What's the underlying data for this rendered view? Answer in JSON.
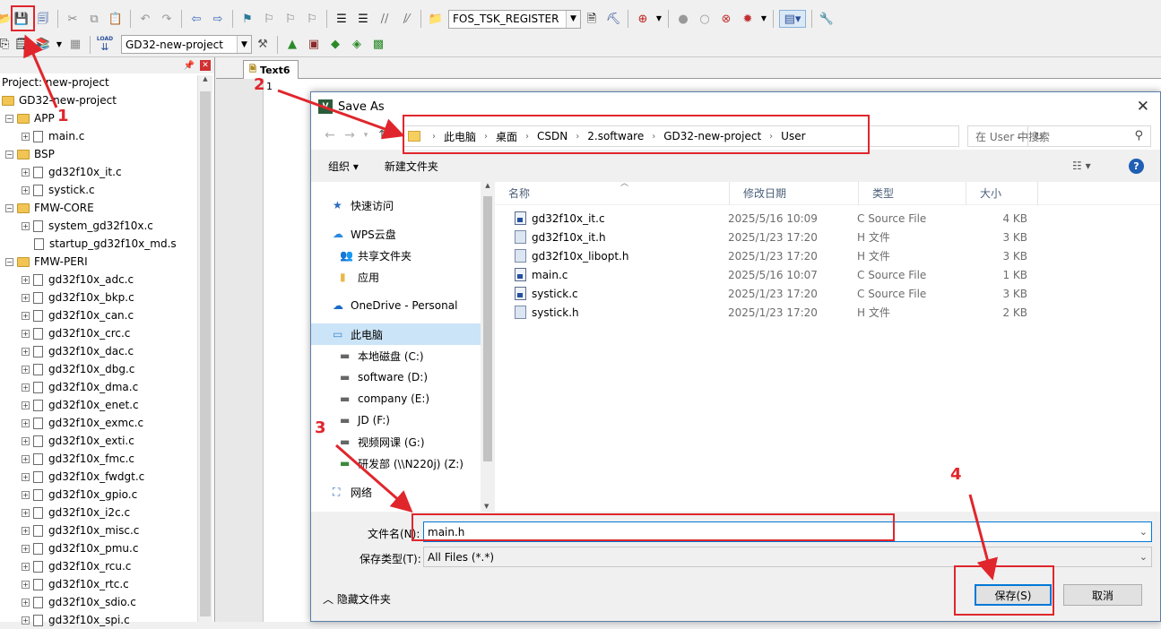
{
  "toolbar1": {
    "combo_value": "FOS_TSK_REGISTER"
  },
  "toolbar2": {
    "target_value": "GD32-new-project",
    "load_label": "LOAD"
  },
  "project": {
    "header": "Project: new-project",
    "root": "GD32-new-project",
    "groups": [
      {
        "name": "APP",
        "files": [
          "main.c"
        ]
      },
      {
        "name": "BSP",
        "files": [
          "gd32f10x_it.c",
          "systick.c"
        ]
      },
      {
        "name": "FMW-CORE",
        "files": [
          "system_gd32f10x.c",
          "startup_gd32f10x_md.s"
        ]
      },
      {
        "name": "FMW-PERI",
        "files": [
          "gd32f10x_adc.c",
          "gd32f10x_bkp.c",
          "gd32f10x_can.c",
          "gd32f10x_crc.c",
          "gd32f10x_dac.c",
          "gd32f10x_dbg.c",
          "gd32f10x_dma.c",
          "gd32f10x_enet.c",
          "gd32f10x_exmc.c",
          "gd32f10x_exti.c",
          "gd32f10x_fmc.c",
          "gd32f10x_fwdgt.c",
          "gd32f10x_gpio.c",
          "gd32f10x_i2c.c",
          "gd32f10x_misc.c",
          "gd32f10x_pmu.c",
          "gd32f10x_rcu.c",
          "gd32f10x_rtc.c",
          "gd32f10x_sdio.c",
          "gd32f10x_spi.c"
        ]
      }
    ]
  },
  "editor": {
    "tab": "Text6",
    "line_number": "1"
  },
  "dialog": {
    "title": "Save As",
    "breadcrumb": [
      "此电脑",
      "桌面",
      "CSDN",
      "2.software",
      "GD32-new-project",
      "User"
    ],
    "search_placeholder": "在 User 中搜索",
    "organize": "组织",
    "new_folder": "新建文件夹",
    "nav": [
      {
        "label": "快速访问",
        "icon": "star-icon"
      },
      {
        "label": "WPS云盘",
        "icon": "cloud-icon"
      },
      {
        "label": "共享文件夹",
        "icon": "shared-folder-icon"
      },
      {
        "label": "应用",
        "icon": "folder-icon"
      },
      {
        "label": "OneDrive - Personal",
        "icon": "onedrive-icon"
      },
      {
        "label": "此电脑",
        "icon": "pc-icon"
      },
      {
        "label": "本地磁盘 (C:)",
        "icon": "drive-icon"
      },
      {
        "label": "software (D:)",
        "icon": "drive-icon"
      },
      {
        "label": "company (E:)",
        "icon": "drive-icon"
      },
      {
        "label": "JD (F:)",
        "icon": "drive-icon"
      },
      {
        "label": "视频网课 (G:)",
        "icon": "drive-icon"
      },
      {
        "label": "研发部 (\\\\N220j) (Z:)",
        "icon": "network-drive-icon"
      },
      {
        "label": "网络",
        "icon": "network-icon"
      }
    ],
    "columns": [
      "名称",
      "修改日期",
      "类型",
      "大小"
    ],
    "files": [
      {
        "name": "gd32f10x_it.c",
        "date": "2025/5/16 10:09",
        "type": "C Source File",
        "size": "4 KB",
        "kind": "c"
      },
      {
        "name": "gd32f10x_it.h",
        "date": "2025/1/23 17:20",
        "type": "H 文件",
        "size": "3 KB",
        "kind": "h"
      },
      {
        "name": "gd32f10x_libopt.h",
        "date": "2025/1/23 17:20",
        "type": "H 文件",
        "size": "3 KB",
        "kind": "h"
      },
      {
        "name": "main.c",
        "date": "2025/5/16 10:07",
        "type": "C Source File",
        "size": "1 KB",
        "kind": "c"
      },
      {
        "name": "systick.c",
        "date": "2025/1/23 17:20",
        "type": "C Source File",
        "size": "3 KB",
        "kind": "c"
      },
      {
        "name": "systick.h",
        "date": "2025/1/23 17:20",
        "type": "H 文件",
        "size": "2 KB",
        "kind": "h"
      }
    ],
    "filename_label": "文件名(N):",
    "filename_value": "main.h",
    "filetype_label": "保存类型(T):",
    "filetype_value": "All Files (*.*)",
    "hide_folders": "隐藏文件夹",
    "save_button": "保存(S)",
    "cancel_button": "取消"
  },
  "annotations": {
    "n1": "1",
    "n2": "2",
    "n3": "3",
    "n4": "4",
    "color": "#e0262c"
  }
}
